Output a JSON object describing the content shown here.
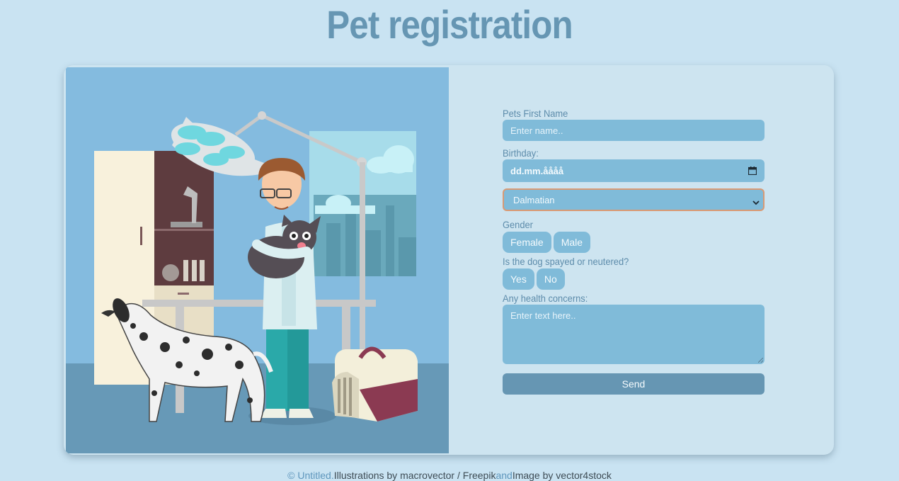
{
  "title": "Pet registration",
  "form": {
    "name_label": "Pets First Name",
    "name_placeholder": "Enter name..",
    "birthday_label": "Birthday:",
    "birthday_placeholder": "dd.mm.åååå",
    "breed_selected": "Dalmatian",
    "gender_label": "Gender",
    "gender_options": [
      "Female",
      "Male"
    ],
    "spayed_label": "Is the dog spayed or neutered?",
    "spayed_options": [
      "Yes",
      "No"
    ],
    "health_label": "Any health concerns:",
    "health_placeholder": "Enter text here..",
    "send_label": "Send"
  },
  "footer": {
    "copyright": "©",
    "untitled_link": "Untitled.",
    "illustrations_text": "Illustrations by macrovector / Freepik",
    "and_text": "and",
    "image_text": "Image by vector4stock"
  },
  "colors": {
    "background": "#c9e3f2",
    "card": "#cde4f0",
    "accent": "#6696b3",
    "field": "#80bbd9",
    "select_border": "#d99a74"
  },
  "icons": {
    "calendar": "calendar-icon",
    "select_arrow": "chevron-down-icon"
  }
}
